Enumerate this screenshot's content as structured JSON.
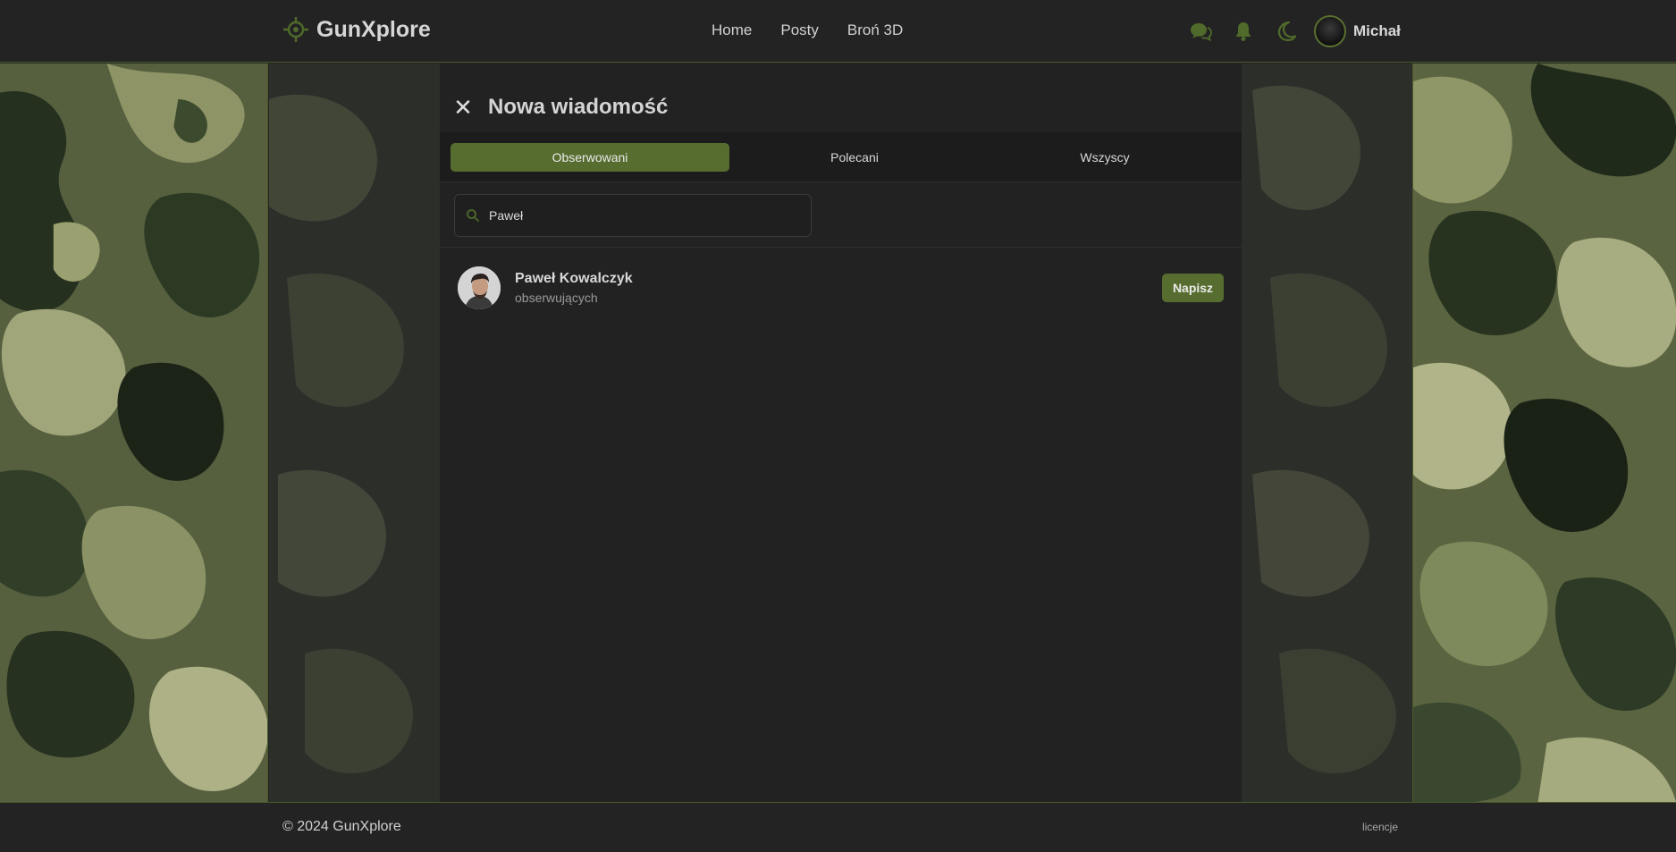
{
  "header": {
    "logo_text": "GunXplore",
    "nav": [
      "Home",
      "Posty",
      "Broń 3D"
    ],
    "user_name": "Michał"
  },
  "modal": {
    "title": "Nowa wiadomość",
    "close_symbol": "✕",
    "tabs": [
      "Obserwowani",
      "Polecani",
      "Wszyscy"
    ],
    "active_tab": "Obserwowani",
    "search_value": "Paweł",
    "results": [
      {
        "name": "Paweł Kowalczyk",
        "subtitle": "obserwujących",
        "action": "Napisz"
      }
    ]
  },
  "footer": {
    "copyright": "© 2024 GunXplore",
    "license_link": "licencje"
  },
  "colors": {
    "accent": "#566d2f",
    "icon_green": "#4f6a2a",
    "background": "#232323",
    "panel": "#222222"
  },
  "icons": [
    "crosshair-logo-icon",
    "chat-icon",
    "bell-icon",
    "moon-icon",
    "close-icon",
    "search-icon"
  ]
}
